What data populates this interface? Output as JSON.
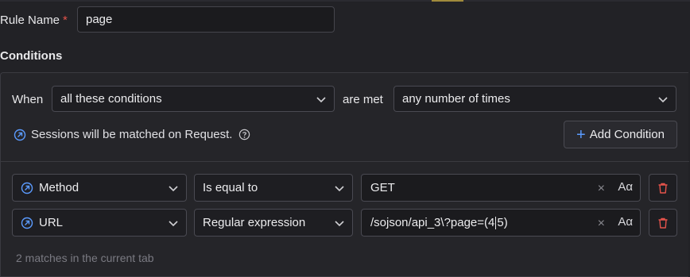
{
  "rule": {
    "label": "Rule Name",
    "required_marker": "*",
    "value": "page"
  },
  "conditions": {
    "title": "Conditions",
    "when_label": "When",
    "match_mode": "all these conditions",
    "are_met_label": "are met",
    "frequency": "any number of times",
    "sessions_note": "Sessions will be matched on Request.",
    "add_button_label": "Add Condition",
    "rows": [
      {
        "field": "Method",
        "operator": "Is equal to",
        "value_before": "GET",
        "value_after": ""
      },
      {
        "field": "URL",
        "operator": "Regular expression",
        "value_before": "/sojson/api_3\\?page=(4",
        "value_after": "5)"
      }
    ],
    "case_toggle_label": "Aα",
    "clear_label": "×",
    "matches_text": "2 matches in the current tab"
  },
  "colors": {
    "accent": "#5b9bff",
    "danger": "#e5534b",
    "background": "#222226",
    "border": "#4a4a52"
  }
}
